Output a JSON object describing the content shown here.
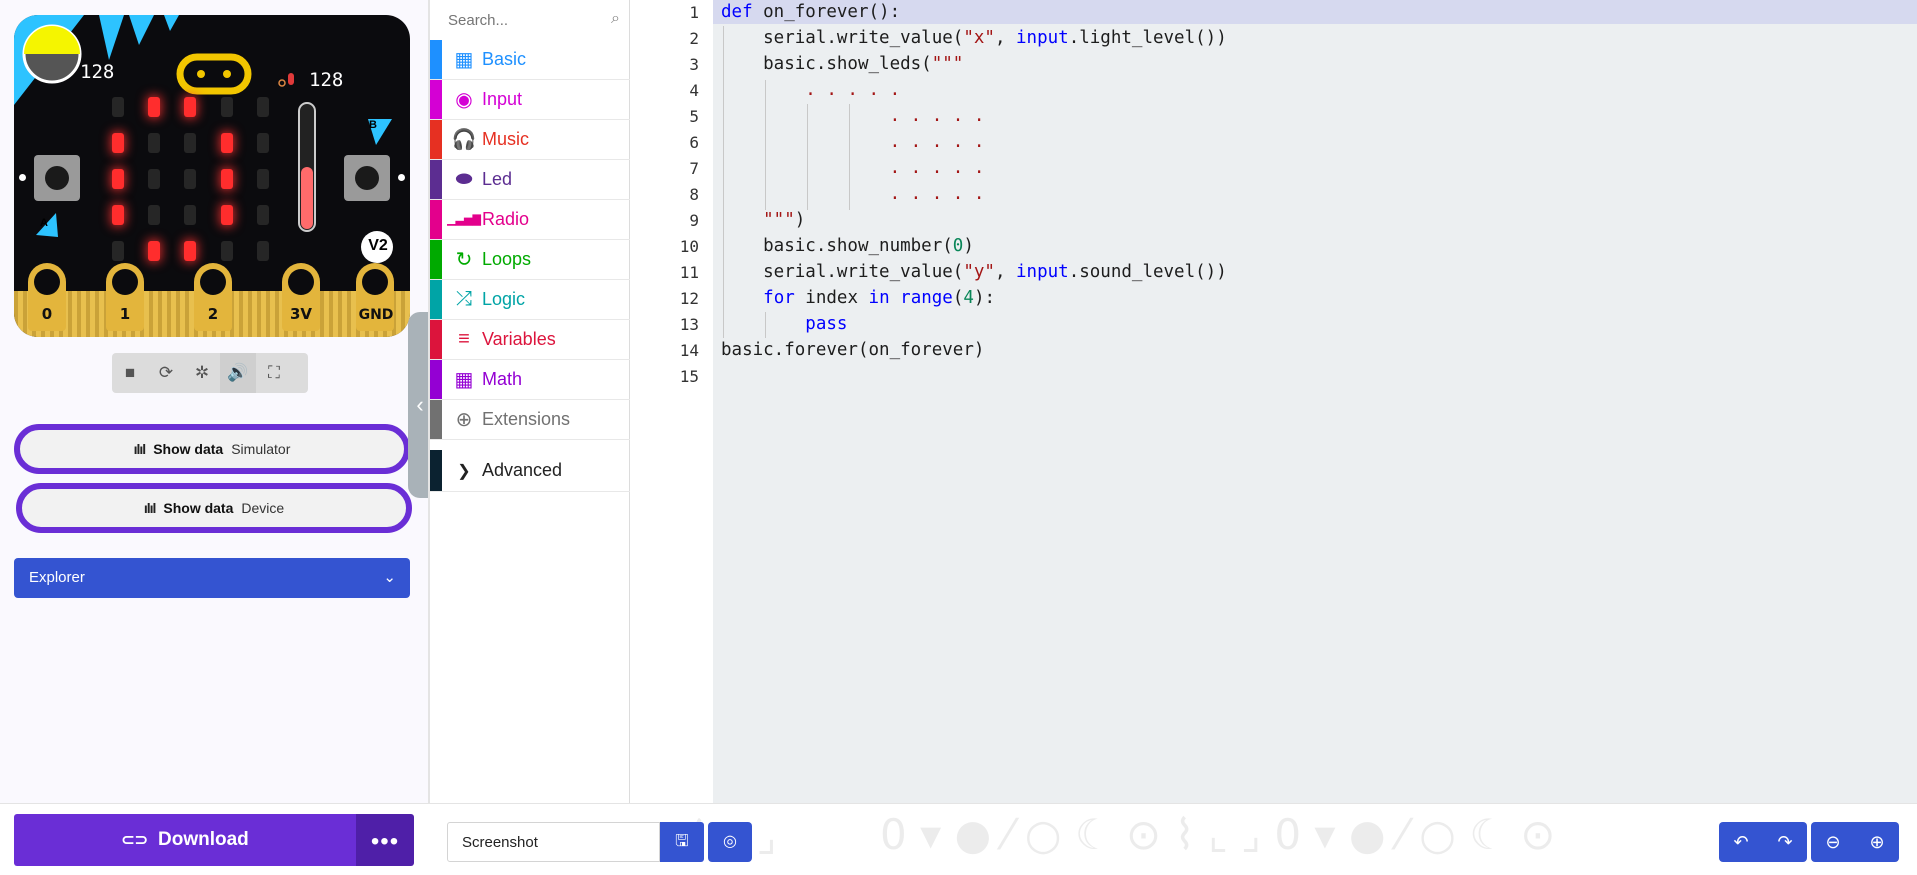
{
  "simulator": {
    "light_value": "128",
    "sound_value": "128",
    "version_badge": "V2",
    "button_a": "A",
    "button_b": "B",
    "pins": [
      "0",
      "1",
      "2",
      "3V",
      "GND"
    ],
    "led_matrix": [
      [
        0,
        1,
        1,
        0,
        0
      ],
      [
        1,
        0,
        0,
        1,
        0
      ],
      [
        1,
        0,
        0,
        1,
        0
      ],
      [
        1,
        0,
        0,
        1,
        0
      ],
      [
        0,
        1,
        1,
        0,
        0
      ]
    ],
    "sound_meter_level": 0.5,
    "controls": [
      "stop-icon",
      "restart-icon",
      "debug-icon",
      "mute-icon",
      "fullscreen-icon"
    ],
    "show_data_simulator": {
      "label": "Show data",
      "target": "Simulator"
    },
    "show_data_device": {
      "label": "Show data",
      "target": "Device"
    },
    "explorer_label": "Explorer"
  },
  "toolbox": {
    "search_placeholder": "Search...",
    "categories": [
      {
        "label": "Basic",
        "color": "#1e90ff",
        "icon": "grid-icon"
      },
      {
        "label": "Input",
        "color": "#d400d4",
        "icon": "input-icon"
      },
      {
        "label": "Music",
        "color": "#e63022",
        "icon": "headphones-icon"
      },
      {
        "label": "Led",
        "color": "#5c2d91",
        "icon": "toggle-icon"
      },
      {
        "label": "Radio",
        "color": "#e3008c",
        "icon": "signal-icon"
      },
      {
        "label": "Loops",
        "color": "#00aa00",
        "icon": "loop-icon"
      },
      {
        "label": "Logic",
        "color": "#00a4a6",
        "icon": "shuffle-icon"
      },
      {
        "label": "Variables",
        "color": "#dc143c",
        "icon": "lines-icon"
      },
      {
        "label": "Math",
        "color": "#9400d3",
        "icon": "calculator-icon"
      },
      {
        "label": "Extensions",
        "color": "#717171",
        "icon": "plus-circle-icon"
      }
    ],
    "advanced_label": "Advanced"
  },
  "editor": {
    "line_numbers": [
      "1",
      "2",
      "3",
      "4",
      "5",
      "6",
      "7",
      "8",
      "9",
      "10",
      "11",
      "12",
      "13",
      "14",
      "15"
    ],
    "current_line": 1
  },
  "bottom_bar": {
    "download_label": "Download",
    "more_label": "•••",
    "project_name": "Screenshot"
  }
}
